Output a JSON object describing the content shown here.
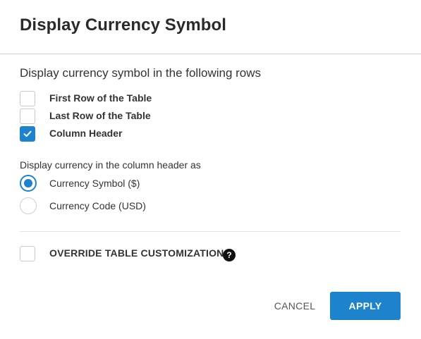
{
  "dialog": {
    "title": "Display Currency Symbol"
  },
  "rows_section": {
    "title": "Display currency symbol in the following rows",
    "options": [
      {
        "label": "First Row of the Table",
        "checked": false
      },
      {
        "label": "Last Row of the Table",
        "checked": false
      },
      {
        "label": "Column Header",
        "checked": true
      }
    ]
  },
  "header_section": {
    "title": "Display currency in the column header as",
    "options": [
      {
        "label": "Currency Symbol ($)",
        "selected": true
      },
      {
        "label": "Currency Code (USD)",
        "selected": false
      }
    ]
  },
  "override": {
    "label": "OVERRIDE TABLE CUSTOMIZATION",
    "checked": false,
    "help_icon": "question-circle-icon",
    "help_glyph": "?"
  },
  "actions": {
    "cancel_label": "CANCEL",
    "apply_label": "APPLY"
  },
  "colors": {
    "accent": "#1d83cc",
    "text": "#333333"
  }
}
